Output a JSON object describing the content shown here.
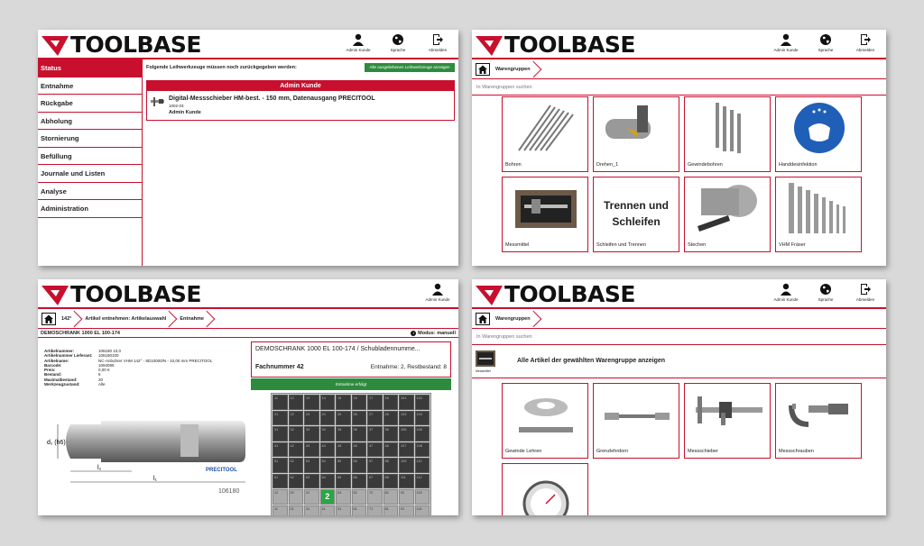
{
  "brand": "TOOLBASE",
  "header_buttons": {
    "admin": "Admin Kunde",
    "language": "Sprache",
    "logout": "Abmelden"
  },
  "panel1": {
    "sidebar": [
      "Status",
      "Entnahme",
      "Rückgabe",
      "Abholung",
      "Stornierung",
      "Befüllung",
      "Journale und Listen",
      "Analyse",
      "Administration"
    ],
    "notice": "Folgende Leihwerkzeuge müssen noch zurückgegeben werden:",
    "green_button": "Alle ausgeliehenen Leihwerkzeuge anzeigen",
    "card_header": "Admin Kunde",
    "item_title": "Digital-Messschieber HM-best. - 150 mm, Datenausgang PRECITOOL",
    "item_code": "1002-03",
    "item_user": "Admin Kunde"
  },
  "panel2": {
    "crumb": "Warengruppen",
    "search_placeholder": "In Warengruppen suchen",
    "tiles": [
      "Bohren",
      "Drehen_1",
      "Gewindebohren",
      "Handdesinfektion",
      "Messmittel",
      "Schleifen und Trennen",
      "Stechen",
      "VHM Fräser"
    ],
    "trennen_text": [
      "Trennen und",
      "Schleifen"
    ]
  },
  "panel3": {
    "crumbs": [
      "142°",
      "Artikel entnehmen: Artikelauswahl",
      "Entnahme"
    ],
    "cabinet_line": "DEMOSCHRANK 1000 EL 100-174",
    "mode": "Modus: manuell",
    "specs": [
      {
        "k": "Artikelnummer:",
        "v": "106180 10,0"
      },
      {
        "k": "Artikelnummer Lieferant:",
        "v": "106180100"
      },
      {
        "k": "Artikelname:",
        "v": "NC-Anbohrer VHM 142° - 8D10000/N - 10,00 mm PRECITOOL"
      },
      {
        "k": "Barcode:",
        "v": "1094095"
      },
      {
        "k": "Preis:",
        "v": "0,00 €"
      },
      {
        "k": "Bestand:",
        "v": "6"
      },
      {
        "k": "Maximalbestand:",
        "v": "20"
      },
      {
        "k": "Werkzeugzustand:",
        "v": "Alle"
      }
    ],
    "drawing": {
      "d": "d₁ (h6)",
      "l2": "l₂",
      "l1": "l₁",
      "number": "106180",
      "brand": "PRECITOOL"
    },
    "cab_title": "DEMOSCHRANK 1000 EL 100-174 / Schubladennumme...",
    "fach": "Fachnummer 42",
    "entnahme": "Entnahme: 2, Restbestand: 8",
    "green_button": "Entnahme erfolgt",
    "selected_qty": "2",
    "grid": [
      "11",
      "12",
      "13",
      "14",
      "15",
      "16",
      "17",
      "18",
      "101",
      "102",
      "21",
      "22",
      "23",
      "24",
      "25",
      "26",
      "27",
      "28",
      "103",
      "104",
      "31",
      "32",
      "33",
      "34",
      "35",
      "36",
      "37",
      "38",
      "105",
      "106",
      "41",
      "42",
      "43",
      "44",
      "45",
      "46",
      "47",
      "48",
      "107",
      "108",
      "51",
      "52",
      "53",
      "54",
      "55",
      "56",
      "57",
      "58",
      "109",
      "110",
      "61",
      "62",
      "63",
      "64",
      "65",
      "66",
      "67",
      "68",
      "111",
      "112",
      "12",
      "20",
      "22",
      "2",
      "63",
      "62",
      "72",
      "82",
      "92",
      "102",
      "11",
      "21",
      "31",
      "41",
      "51",
      "61",
      "71",
      "81",
      "91",
      "101"
    ]
  },
  "panel4": {
    "crumb": "Warengruppen",
    "search_placeholder": "In Warengruppen suchen",
    "all_caption": "Messmittel",
    "all_text": "Alle Artikel der gewählten Warengruppe anzeigen",
    "tiles": [
      "Gewinde Lehren",
      "Grenzlehrdorn",
      "Messschieber",
      "Messschrauben"
    ]
  }
}
